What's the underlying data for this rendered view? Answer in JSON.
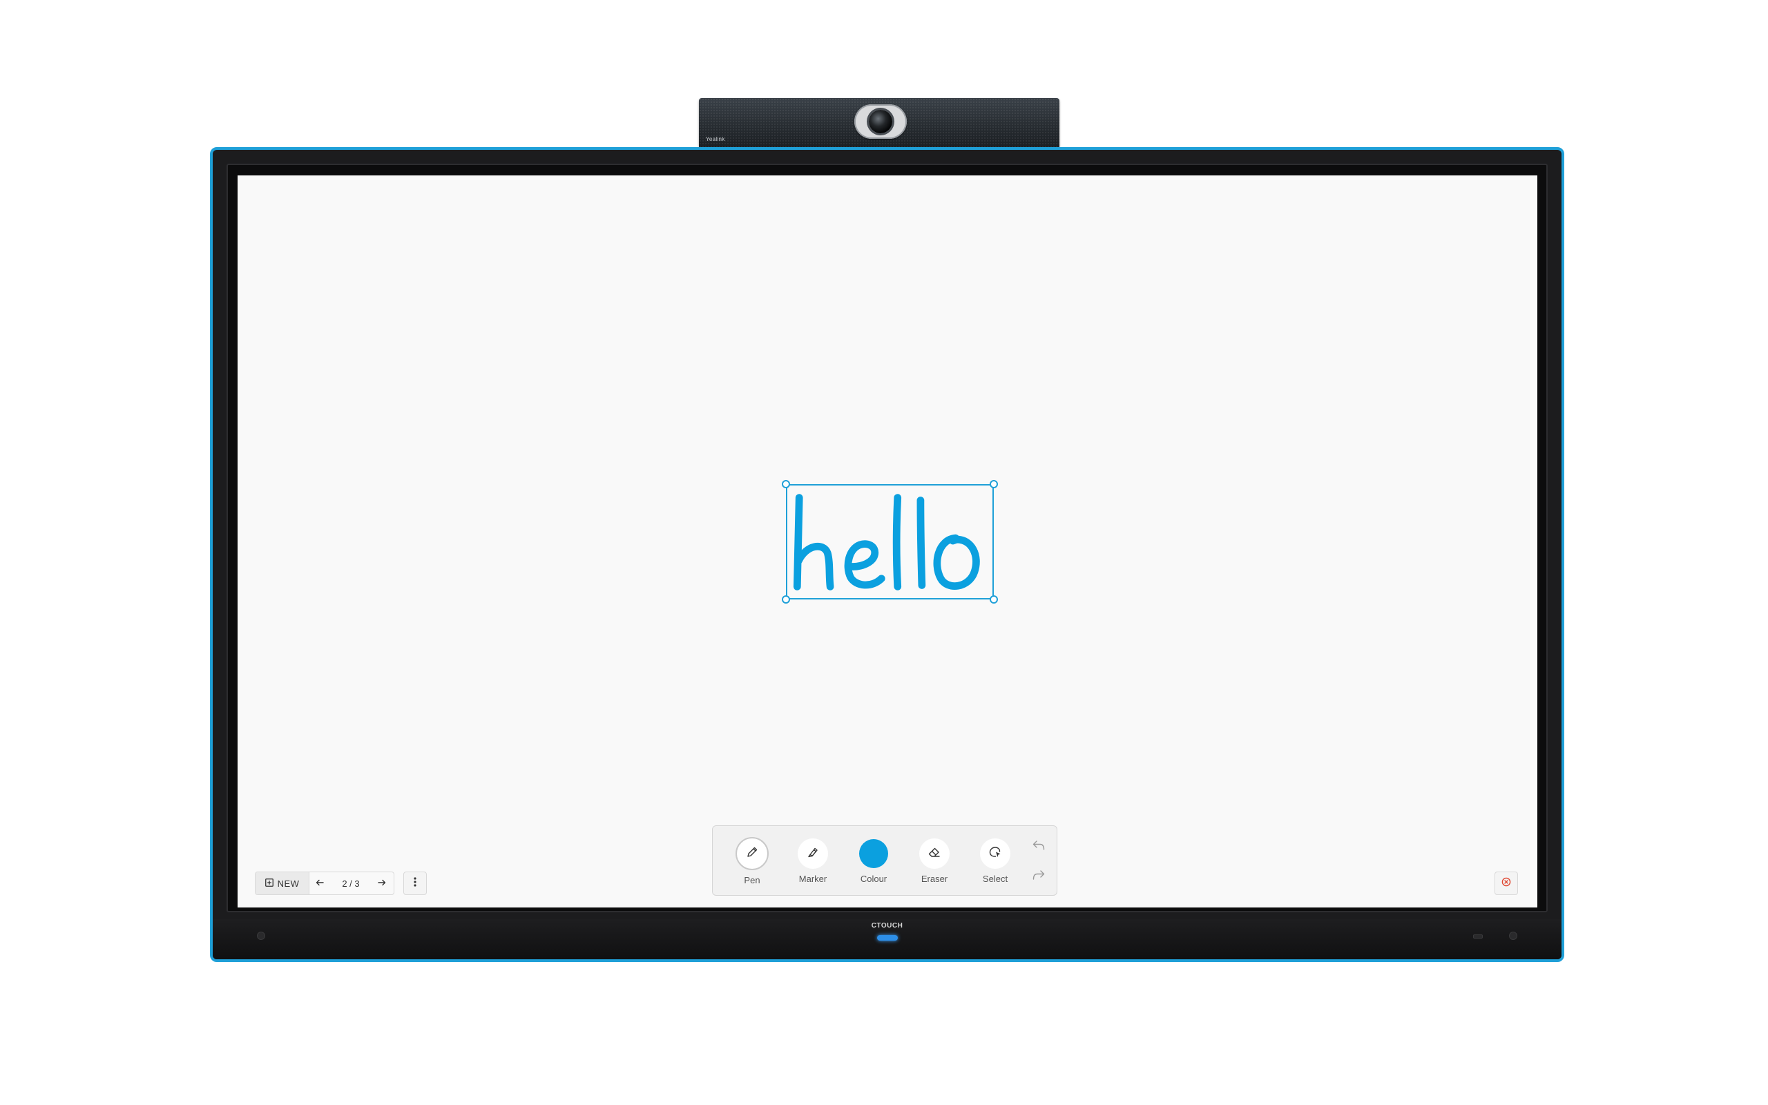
{
  "camera": {
    "brand": "Yealink"
  },
  "display": {
    "brand": "CTOUCH",
    "accent_color": "#1fa0d8"
  },
  "canvas": {
    "ink_text": "hello",
    "ink_color": "#0ba0df",
    "selection_color": "#1fa0d8"
  },
  "page_controls": {
    "new_label": "NEW",
    "page_indicator": "2 / 3"
  },
  "toolbar": {
    "tools": [
      {
        "label": "Pen",
        "icon": "pen-icon",
        "active": true
      },
      {
        "label": "Marker",
        "icon": "marker-icon",
        "active": false
      },
      {
        "label": "Colour",
        "icon": "colour-swatch",
        "color": "#0ba0df"
      },
      {
        "label": "Eraser",
        "icon": "eraser-icon",
        "active": false
      },
      {
        "label": "Select",
        "icon": "lasso-select-icon",
        "active": false
      }
    ],
    "undo_icon": "undo-icon",
    "redo_icon": "redo-icon"
  },
  "exit_icon": "exit-icon"
}
